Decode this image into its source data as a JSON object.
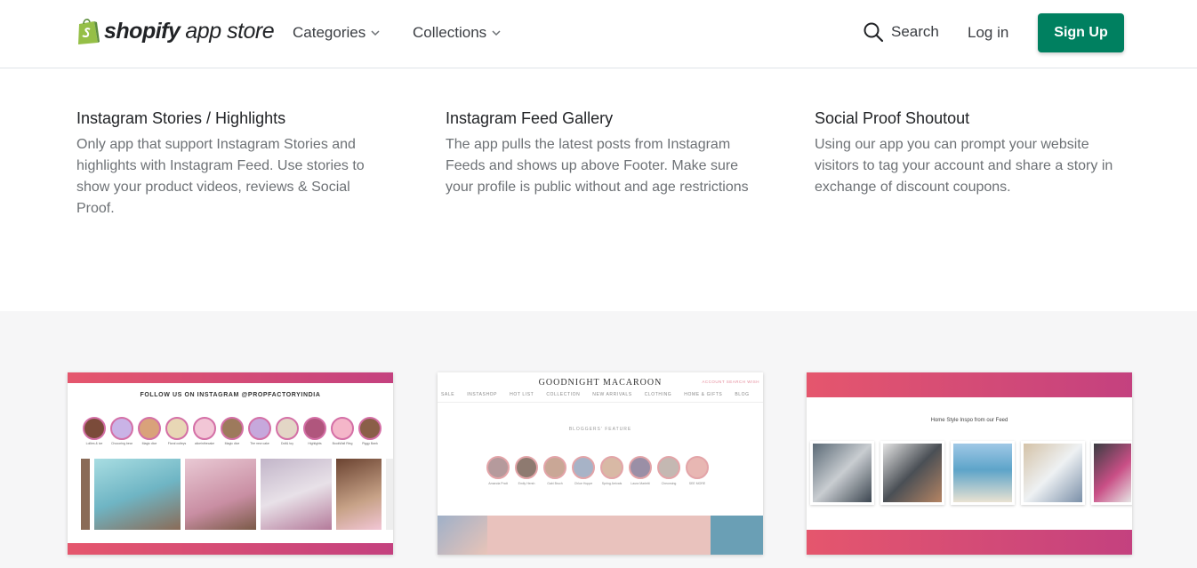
{
  "header": {
    "logo_bold": "shopify",
    "logo_light": "app store",
    "nav": [
      {
        "label": "Categories"
      },
      {
        "label": "Collections"
      }
    ],
    "search_label": "Search",
    "login_label": "Log in",
    "signup_label": "Sign Up"
  },
  "features": [
    {
      "title": "Instagram Stories / Highlights",
      "description": "Only app that support Instagram Stories and highlights with Instagram Feed. Use stories to show your product videos, reviews & Social Proof."
    },
    {
      "title": "Instagram Feed Gallery",
      "description": "The app pulls the latest posts from Instagram Feeds and shows up above Footer. Make sure your profile is public without and age restrictions"
    },
    {
      "title": "Social Proof Shoutout",
      "description": "Using our app you can prompt your website visitors to tag your account and share a story in exchange of discount coupons."
    }
  ],
  "gallery": {
    "card1": {
      "heading": "FOLLOW US ON INSTAGRAM @PROPFACTORYINDIA",
      "story_labels": [
        "Lollies & ice",
        "Chocoring bear",
        "Magic dice",
        "Floral cutleys",
        "aliceinthecake",
        "Magic dice",
        "The new cake",
        "Doll& toy",
        "Highlights",
        "BookWall Ring",
        "Piggy Bank"
      ]
    },
    "card2": {
      "brand": "GOODNIGHT MACAROON",
      "account_links": "ACCOUNT  SEARCH  WISH",
      "menu": [
        "SALE",
        "INSTASHOP",
        "HOT LIST",
        "COLLECTION",
        "NEW ARRIVALS",
        "CLOTHING",
        "HOME & GIFTS",
        "BLOG"
      ],
      "section_label": "BLOGGERS' FEATURE",
      "story_labels": [
        "Amanda Pratt",
        "Emily Hersh",
        "Gabi Bruch",
        "Chloe Hoppe",
        "Spring Arrivals",
        "Laura Marietti",
        "Cheonsing",
        "SEE MORE"
      ]
    },
    "card3": {
      "heading": "Home Style Inspo from our Feed"
    }
  },
  "colors": {
    "brand_green": "#008060",
    "gradient_start": "#e5566d",
    "gradient_end": "#c4417f"
  }
}
